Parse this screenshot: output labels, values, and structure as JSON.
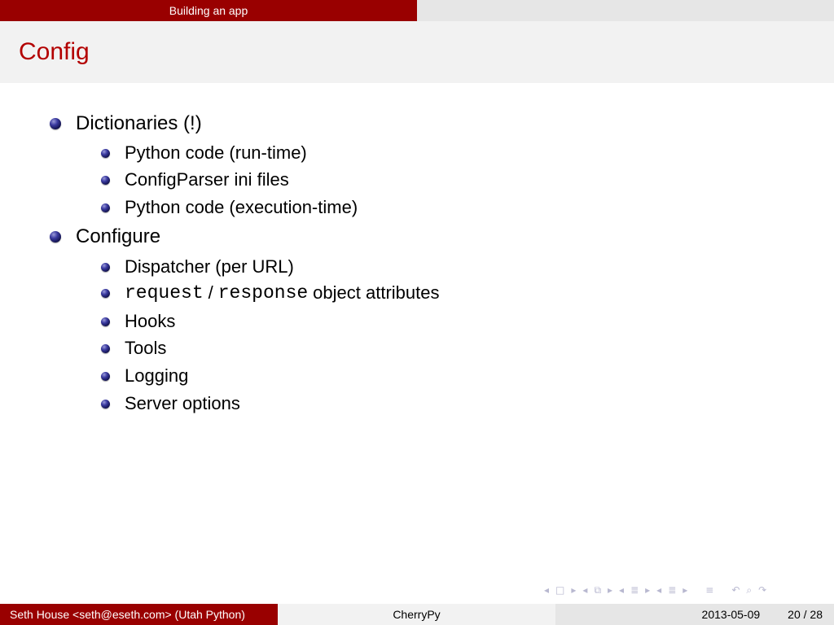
{
  "header": {
    "section": "Building an app"
  },
  "frame": {
    "title": "Config"
  },
  "bullets": {
    "item1": {
      "label": "Dictionaries (!)",
      "sub1": "Python code (run-time)",
      "sub2": "ConfigParser ini files",
      "sub3": "Python code (execution-time)"
    },
    "item2": {
      "label": "Configure",
      "sub1": "Dispatcher (per URL)",
      "sub2_code1": "request",
      "sub2_sep": "/",
      "sub2_code2": "response",
      "sub2_text": "object attributes",
      "sub3": "Hooks",
      "sub4": "Tools",
      "sub5": "Logging",
      "sub6": "Server options"
    }
  },
  "footer": {
    "author": "Seth House <seth@eseth.com>  (Utah Python)",
    "title": "CherryPy",
    "date": "2013-05-09",
    "page": "20 / 28"
  },
  "icons": [
    "nav-prev-frame-icon",
    "nav-frame-icon",
    "nav-next-frame-icon",
    "nav-prev-subsection-icon",
    "nav-subsection-icon",
    "nav-next-subsection-icon",
    "nav-prev-section-icon",
    "nav-section-icon",
    "nav-next-section-icon",
    "nav-document-icon",
    "nav-back-icon",
    "nav-search-icon",
    "nav-forward-icon"
  ],
  "colors": {
    "accent": "#990000",
    "title": "#b30000",
    "bullet": "#2a2a8a"
  }
}
